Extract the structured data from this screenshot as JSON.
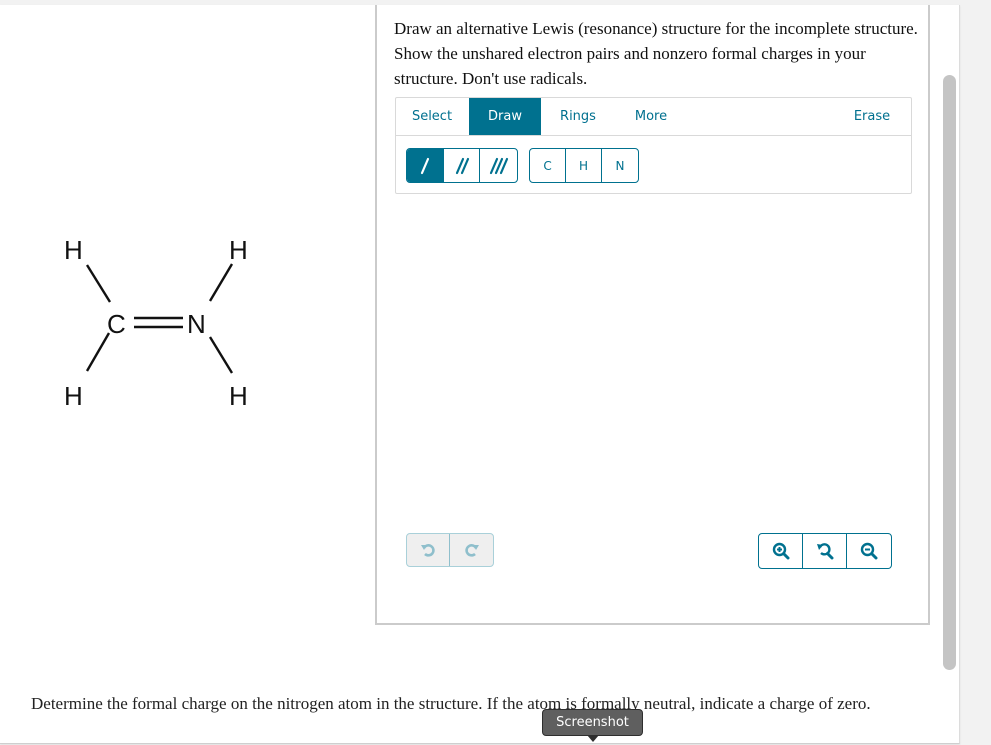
{
  "molecule": {
    "atoms": [
      {
        "symbol": "H",
        "role": "carbon-hydrogen-top"
      },
      {
        "symbol": "H",
        "role": "carbon-hydrogen-bottom"
      },
      {
        "symbol": "C",
        "role": "carbon"
      },
      {
        "symbol": "N",
        "role": "nitrogen"
      },
      {
        "symbol": "H",
        "role": "nitrogen-hydrogen-top"
      },
      {
        "symbol": "H",
        "role": "nitrogen-hydrogen-bottom"
      }
    ],
    "bonds": [
      {
        "from": "C",
        "to": "H",
        "order": 1
      },
      {
        "from": "C",
        "to": "H",
        "order": 1
      },
      {
        "from": "C",
        "to": "N",
        "order": 2
      },
      {
        "from": "N",
        "to": "H",
        "order": 1
      },
      {
        "from": "N",
        "to": "H",
        "order": 1
      }
    ]
  },
  "question": {
    "prompt": "Draw an alternative Lewis (resonance) structure for the incomplete structure. Show the unshared electron pairs and nonzero formal charges in your structure. Don't use radicals.",
    "followup": "Determine the formal charge on the nitrogen atom in the structure. If the atom is formally neutral, indicate a charge of zero."
  },
  "toolbar": {
    "tabs": [
      {
        "label": "Select",
        "active": false
      },
      {
        "label": "Draw",
        "active": true
      },
      {
        "label": "Rings",
        "active": false
      },
      {
        "label": "More",
        "active": false
      }
    ],
    "erase_label": "Erase",
    "bond_buttons": [
      {
        "name": "single-bond",
        "active": true
      },
      {
        "name": "double-bond",
        "active": false
      },
      {
        "name": "triple-bond",
        "active": false
      }
    ],
    "atom_buttons": [
      "C",
      "H",
      "N"
    ]
  },
  "canvas_controls": {
    "undo_icon": "undo-icon",
    "redo_icon": "redo-icon",
    "zoom_in_icon": "zoom-in-icon",
    "zoom_reset_icon": "zoom-reset-icon",
    "zoom_out_icon": "zoom-out-icon"
  },
  "tooltip": {
    "text": "Screenshot"
  },
  "colors": {
    "accent": "#00718f",
    "disabled": "#8fbfcc",
    "panel_border": "#cbcbcb"
  }
}
